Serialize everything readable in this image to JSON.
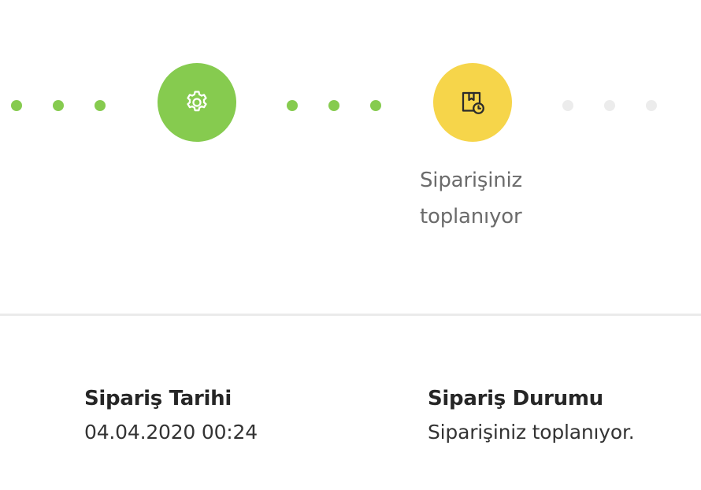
{
  "colors": {
    "done": "#86cb4f",
    "active": "#f6d54a",
    "pending": "#ececec"
  },
  "tracker": {
    "steps": [
      {
        "icon": "gear-icon",
        "state": "done"
      },
      {
        "icon": "package-clock-icon",
        "state": "active",
        "label_line1": "Siparişiniz",
        "label_line2": "toplanıyor"
      }
    ]
  },
  "order_info": {
    "date": {
      "title": "Sipariş Tarihi",
      "value": "04.04.2020 00:24"
    },
    "status": {
      "title": "Sipariş Durumu",
      "value": "Siparişiniz toplanıyor."
    }
  }
}
